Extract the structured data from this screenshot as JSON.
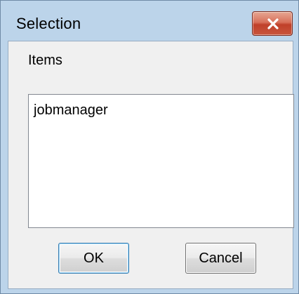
{
  "window": {
    "title": "Selection",
    "close_icon": "close-x-icon"
  },
  "content": {
    "items_label": "Items",
    "list_items": [
      "jobmanager"
    ]
  },
  "buttons": {
    "ok_label": "OK",
    "cancel_label": "Cancel"
  },
  "colors": {
    "frame": "#bcd4ea",
    "client": "#f0f0f0",
    "close_button": "#c8553d",
    "default_button_border": "#3c7fb1"
  }
}
